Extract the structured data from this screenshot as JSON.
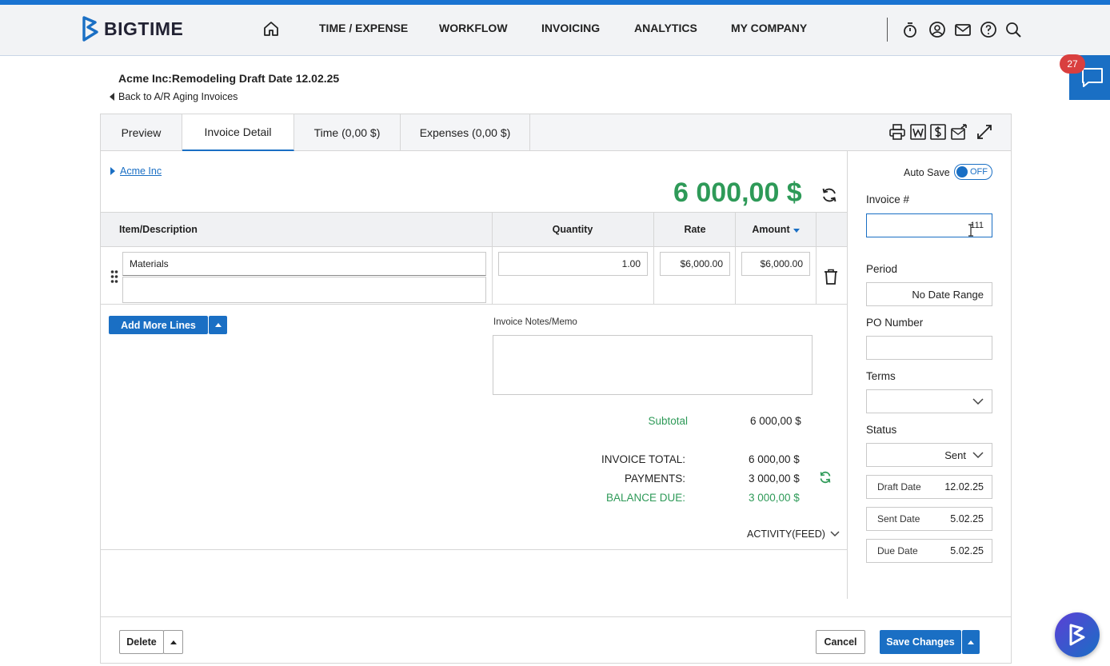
{
  "brand": {
    "name": "BIGTIME",
    "accent": "#1a6fc4",
    "green": "#2e9a58"
  },
  "nav": {
    "items": [
      "TIME / EXPENSE",
      "WORKFLOW",
      "INVOICING",
      "ANALYTICS",
      "MY COMPANY"
    ],
    "icons": [
      "home-icon",
      "stopwatch-icon",
      "user-circle-icon",
      "mail-icon",
      "help-icon",
      "search-icon"
    ]
  },
  "chat": {
    "badge": "27"
  },
  "page": {
    "title": "Acme Inc:Remodeling Draft Date 12.02.25",
    "back": "Back to A/R Aging Invoices"
  },
  "tabs": [
    {
      "label": "Preview"
    },
    {
      "label": "Invoice Detail",
      "active": true
    },
    {
      "label": "Time (0,00 $)"
    },
    {
      "label": "Expenses (0,00 $)"
    }
  ],
  "toolbar_icons": [
    "print-icon",
    "word-icon",
    "dollar-doc-icon",
    "send-icon",
    "expand-icon"
  ],
  "invoice": {
    "client": "Acme Inc",
    "total_big": "6 000,00 $",
    "columns": {
      "item": "Item/Description",
      "quantity": "Quantity",
      "rate": "Rate",
      "amount": "Amount"
    },
    "lines": [
      {
        "item": "Materials",
        "description": "",
        "quantity": "1.00",
        "rate": "$6,000.00",
        "amount": "$6,000.00"
      }
    ],
    "add_lines": "Add More Lines",
    "notes_label": "Invoice Notes/Memo",
    "notes": "",
    "subtotal_label": "Subtotal",
    "subtotal": "6 000,00 $",
    "total_label": "INVOICE TOTAL:",
    "total": "6 000,00 $",
    "payments_label": "PAYMENTS:",
    "payments": "3 000,00 $",
    "balance_label": "BALANCE DUE:",
    "balance": "3 000,00 $",
    "activity": "ACTIVITY(FEED)"
  },
  "sidebar": {
    "autosave_label": "Auto Save",
    "autosave_state": "OFF",
    "invoice_no_label": "Invoice #",
    "invoice_no": "111",
    "period_label": "Period",
    "period": "No Date Range",
    "po_label": "PO Number",
    "po": "",
    "terms_label": "Terms",
    "terms": "",
    "status_label": "Status",
    "status": "Sent",
    "draft_label": "Draft Date",
    "draft": "12.02.25",
    "sent_label": "Sent Date",
    "sent": "5.02.25",
    "due_label": "Due Date",
    "due": "5.02.25"
  },
  "footer": {
    "delete": "Delete",
    "cancel": "Cancel",
    "save": "Save Changes"
  }
}
